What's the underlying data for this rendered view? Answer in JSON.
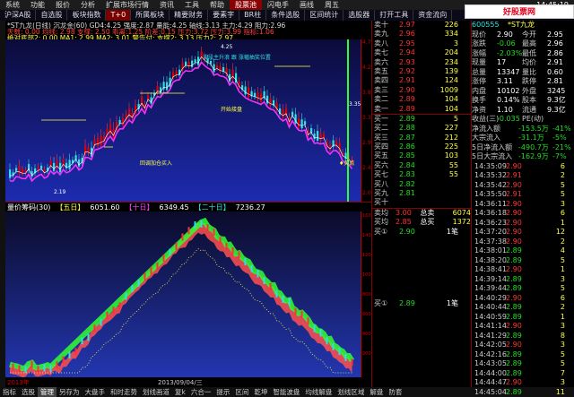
{
  "menubar": {
    "items": [
      "系统",
      "功能",
      "报价",
      "分析",
      "扩展市场行情",
      "资讯",
      "工具",
      "帮助"
    ],
    "stock_select": "股票池",
    "right_items": [
      "闪电手",
      "画线",
      "周五"
    ],
    "clock": "14:45:19"
  },
  "logo": "好股票网 Goodgupiao.com",
  "toolbar": {
    "tabs": [
      "沪深A股",
      "自选股",
      "板块指数",
      "T+0",
      "所属板块",
      "精要财务",
      "要素字",
      "BR柱",
      "条件选股",
      "区间统计",
      "选股器",
      "打开工具",
      "资金流向"
    ],
    "active": "T+0"
  },
  "chart_header": {
    "line1": "*ST九龙(日线) 沉龙金(60)  GD4:4.25 强度:2.87 量能:4.25 轴线:3.13 主力:4.29 阻力:2.96",
    "line2": "天数: 0.00  均线: 2.98  支撑: 2.50  乖离:1.25  阶差:0.15  压力:3.72 压力:3.99  指标:1.06",
    "line3": "绝对底部2: 0.00  MA1: 2.99  MA2: 3.01  警告付: 支撑2: 3.13  压力2: 2.97",
    "annotation1": "波段主升浪 跟 涨幅抽奖位置",
    "annotation2": "开始接盘",
    "annotation3": "回调加仓买入",
    "annotation4": "买点",
    "buy_marker": "♦买点",
    "price_label_top": "4.25",
    "price_label_low": "2.19",
    "price_right": "3.35",
    "price_right2": "2.19"
  },
  "vol_header": {
    "title": "量价筹码(30)",
    "five": "【五日】",
    "five_val": "6051.60",
    "ten": "【十日】",
    "ten_val": "6349.45",
    "twenty": "【二十日】",
    "twenty_val": "7236.27",
    "date": "2013/09/04/三",
    "year": "2013年"
  },
  "vol_axis": [
    "16000",
    "14000",
    "12000",
    "10000",
    "8000",
    "6000",
    "4000",
    "2000"
  ],
  "main_axis": [
    "4.70",
    "4.25",
    "3.80",
    "3.35",
    "2.90",
    "2.45",
    "2.00"
  ],
  "bottombar": [
    "指标",
    "选股",
    "管理",
    "另存为",
    "大盘手",
    "和时走势",
    "划线画道",
    "复k",
    "六合一",
    "提示",
    "区间",
    "乾坤",
    "智能波盘",
    "均线解盘",
    "划线区域",
    "解盘",
    "防套"
  ],
  "bottom_active": "管理",
  "orderbook": {
    "sells": [
      {
        "l": "卖十",
        "p": "2.97",
        "v": "226",
        "c": "red"
      },
      {
        "l": "卖九",
        "p": "2.96",
        "v": "334",
        "c": "red"
      },
      {
        "l": "卖八",
        "p": "2.95",
        "v": "3",
        "c": "red"
      },
      {
        "l": "卖七",
        "p": "2.94",
        "v": "204",
        "c": "red"
      },
      {
        "l": "卖六",
        "p": "2.93",
        "v": "234",
        "c": "red"
      },
      {
        "l": "卖五",
        "p": "2.92",
        "v": "139",
        "c": "red"
      },
      {
        "l": "卖四",
        "p": "2.91",
        "v": "124",
        "c": "red"
      },
      {
        "l": "卖三",
        "p": "2.90",
        "v": "1009",
        "c": "red"
      },
      {
        "l": "卖二",
        "p": "2.89",
        "v": "104",
        "c": "red"
      },
      {
        "l": "卖一",
        "p": "2.89",
        "v": "104",
        "c": "red"
      }
    ],
    "buys": [
      {
        "l": "买一",
        "p": "2.89",
        "v": "5",
        "c": "grn"
      },
      {
        "l": "买二",
        "p": "2.88",
        "v": "227",
        "c": "grn"
      },
      {
        "l": "买三",
        "p": "2.87",
        "v": "212",
        "c": "grn"
      },
      {
        "l": "买四",
        "p": "2.86",
        "v": "225",
        "c": "grn"
      },
      {
        "l": "买五",
        "p": "2.85",
        "v": "103",
        "c": "grn"
      },
      {
        "l": "买六",
        "p": "2.84",
        "v": "55",
        "c": "grn"
      },
      {
        "l": "买七",
        "p": "2.83",
        "v": "55",
        "c": "grn"
      },
      {
        "l": "买八",
        "p": "2.82",
        "v": "",
        "c": "grn"
      },
      {
        "l": "买九",
        "p": "2.81",
        "v": "",
        "c": "grn"
      },
      {
        "l": "买十",
        "p": "",
        "v": "",
        "c": "grn"
      }
    ],
    "summary": [
      {
        "l": "卖均",
        "p": "3.00",
        "k": "总卖",
        "v": "6074"
      },
      {
        "l": "买均",
        "p": "2.85",
        "k": "总买",
        "v": "1372"
      }
    ],
    "last_trade": {
      "label": "买①",
      "price": "2.89",
      "vol": "1笔"
    },
    "last_trade2": {
      "label": "买①",
      "price": "2.90",
      "vol": "1笔"
    },
    "change_badge": "+622"
  },
  "info": {
    "code": "600555",
    "name": "*ST九龙",
    "rows": [
      [
        "现价",
        "2.90",
        "今开",
        "2.95"
      ],
      [
        "涨跌",
        "-0.06",
        "最高",
        "2.96"
      ],
      [
        "涨幅",
        "-2.03%",
        "最低",
        "2.86"
      ],
      [
        "现量",
        "17",
        "均价",
        "2.91"
      ],
      [
        "总量",
        "13347",
        "量比",
        "0.60"
      ],
      [
        "涨停",
        "3.11",
        "跌停",
        "2.81"
      ],
      [
        "内盘",
        "10102",
        "外盘",
        "3245"
      ],
      [
        "换手",
        "0.14%",
        "股本",
        "9.3亿"
      ],
      [
        "净资",
        "1.10",
        "流通",
        "9.3亿"
      ],
      [
        "收益(三)",
        "-0.035",
        "PE(动)",
        ""
      ]
    ],
    "flows": [
      {
        "k": "净流入额",
        "v": "-153.5万",
        "p": "-41%"
      },
      {
        "k": "大宗流入",
        "v": "-31.1万",
        "p": "-5%"
      },
      {
        "k": "5日净流入额",
        "v": "-490.7万",
        "p": "-21%"
      },
      {
        "k": "5日大宗流入",
        "v": "-162.9万",
        "p": "-7%"
      }
    ],
    "ticks": [
      [
        "14:35:09",
        "2.90",
        "6"
      ],
      [
        "14:35:32",
        "2.91",
        "2"
      ],
      [
        "14:35:42",
        "2.90",
        "5"
      ],
      [
        "14:35:50",
        "2.91",
        "5"
      ],
      [
        "14:36:11",
        "2.90",
        "3"
      ],
      [
        "14:36:18",
        "2.90",
        "6"
      ],
      [
        "14:36:23",
        "2.90",
        "1"
      ],
      [
        "14:37:20",
        "2.90",
        "12"
      ],
      [
        "14:37:38",
        "2.90",
        "2"
      ],
      [
        "14:38:01",
        "2.89",
        "4"
      ],
      [
        "14:38:20",
        "2.89",
        "5"
      ],
      [
        "14:38:41",
        "2.90",
        "1"
      ],
      [
        "14:39:14",
        "2.89",
        "3"
      ],
      [
        "14:39:44",
        "2.89",
        "5"
      ],
      [
        "14:40:29",
        "2.90",
        "6"
      ],
      [
        "14:40:44",
        "2.89",
        "2"
      ],
      [
        "14:40:59",
        "2.89",
        "1"
      ],
      [
        "14:41:14",
        "2.90",
        "3"
      ],
      [
        "14:41:29",
        "2.89",
        "8"
      ],
      [
        "14:42:05",
        "2.90",
        "3"
      ],
      [
        "14:42:16",
        "2.89",
        "5"
      ],
      [
        "14:43:05",
        "2.89",
        "5"
      ],
      [
        "14:44:00",
        "2.89",
        "7"
      ],
      [
        "14:44:47",
        "2.90",
        "3"
      ],
      [
        "14:45:04",
        "2.89",
        "11"
      ]
    ]
  }
}
